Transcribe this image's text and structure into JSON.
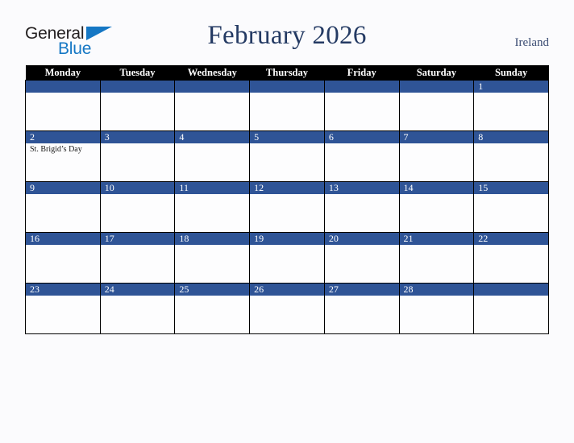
{
  "brand": {
    "logo_line1": "General",
    "logo_line2": "Blue",
    "logo_triangle_color": "#1577c4",
    "logo_text_color": "#231f20"
  },
  "header": {
    "title": "February 2026",
    "country": "Ireland",
    "title_color": "#243a63"
  },
  "colors": {
    "header_row_background": "#000000",
    "header_row_text": "#ffffff",
    "date_bar_background": "#2f5496",
    "date_bar_text": "#ffffff",
    "page_background": "#fbfbfd",
    "cell_background": "#fdfdfe",
    "grid_line": "#000000"
  },
  "calendar": {
    "month": "February",
    "year": "2026",
    "weekday_headers": [
      "Monday",
      "Tuesday",
      "Wednesday",
      "Thursday",
      "Friday",
      "Saturday",
      "Sunday"
    ],
    "weeks": [
      [
        {
          "day": "",
          "events": []
        },
        {
          "day": "",
          "events": []
        },
        {
          "day": "",
          "events": []
        },
        {
          "day": "",
          "events": []
        },
        {
          "day": "",
          "events": []
        },
        {
          "day": "",
          "events": []
        },
        {
          "day": "1",
          "events": []
        }
      ],
      [
        {
          "day": "2",
          "events": [
            "St. Brigid’s Day"
          ]
        },
        {
          "day": "3",
          "events": []
        },
        {
          "day": "4",
          "events": []
        },
        {
          "day": "5",
          "events": []
        },
        {
          "day": "6",
          "events": []
        },
        {
          "day": "7",
          "events": []
        },
        {
          "day": "8",
          "events": []
        }
      ],
      [
        {
          "day": "9",
          "events": []
        },
        {
          "day": "10",
          "events": []
        },
        {
          "day": "11",
          "events": []
        },
        {
          "day": "12",
          "events": []
        },
        {
          "day": "13",
          "events": []
        },
        {
          "day": "14",
          "events": []
        },
        {
          "day": "15",
          "events": []
        }
      ],
      [
        {
          "day": "16",
          "events": []
        },
        {
          "day": "17",
          "events": []
        },
        {
          "day": "18",
          "events": []
        },
        {
          "day": "19",
          "events": []
        },
        {
          "day": "20",
          "events": []
        },
        {
          "day": "21",
          "events": []
        },
        {
          "day": "22",
          "events": []
        }
      ],
      [
        {
          "day": "23",
          "events": []
        },
        {
          "day": "24",
          "events": []
        },
        {
          "day": "25",
          "events": []
        },
        {
          "day": "26",
          "events": []
        },
        {
          "day": "27",
          "events": []
        },
        {
          "day": "28",
          "events": []
        },
        {
          "day": "",
          "events": []
        }
      ]
    ]
  }
}
